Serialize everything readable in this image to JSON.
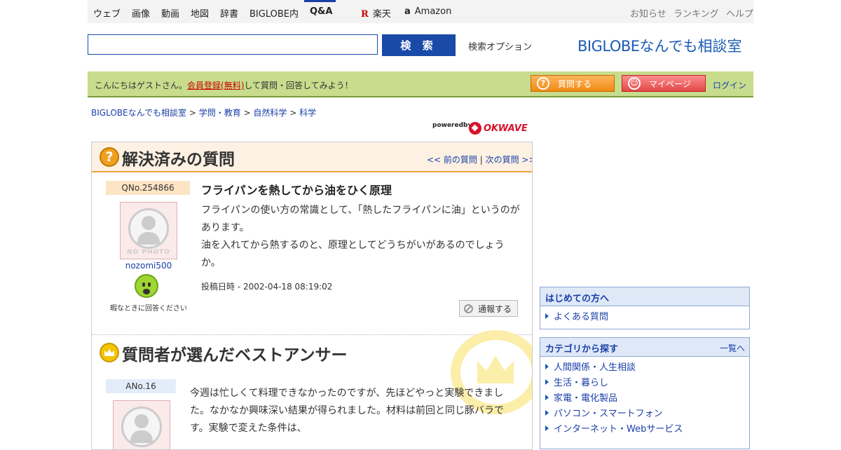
{
  "topnav": {
    "items": [
      "ウェブ",
      "画像",
      "動画",
      "地図",
      "辞書",
      "BIGLOBE内",
      "Q&A"
    ],
    "rakuten": "楽天",
    "amazon": "Amazon",
    "right": [
      "お知らせ",
      "ランキング",
      "ヘルプ"
    ]
  },
  "search": {
    "value": "",
    "button": "検 索",
    "option": "検索オプション",
    "brand_big": "BIGLOBE",
    "brand_rest": "なんでも相談室"
  },
  "greet": {
    "prefix": "こんにちはゲストさん。",
    "register": "会員登録(無料)",
    "suffix": "して質問・回答してみよう！",
    "ask_button": "質問する",
    "mypage_button": "マイページ",
    "login": "ログイン"
  },
  "breadcrumb": [
    "BIGLOBEなんでも相談室",
    "学問・教育",
    "自然科学",
    "科学"
  ],
  "powered": {
    "by": "poweredby",
    "okwave": "OKWAVE"
  },
  "question": {
    "section_title": "解決済みの質問",
    "prev": "<< 前の質問",
    "next": "次の質問 >>",
    "number": "QNo.254866",
    "title": "フライパンを熱してから油をひく原理",
    "body": "フライパンの使い方の常識として、「熱したフライパンに油」というのがあります。\n油を入れてから熱するのと、原理としてどうちがいがあるのでしょうか。",
    "posted": "投稿日時 - 2002-04-18 08:19:02",
    "report": "通報する",
    "user": {
      "name": "nozomi500",
      "no_photo": "NO PHOTO",
      "status": "暇なときに回答ください"
    }
  },
  "best": {
    "section_title": "質問者が選んだベストアンサー",
    "number": "ANo.16",
    "body": "今週は忙しくて料理できなかったのですが、先ほどやっと実験できました。なかなか興味深い結果が得られました。材料は前回と同じ豚バラです。実験で変えた条件は、"
  },
  "sidebar": {
    "first": {
      "title": "はじめての方へ",
      "items": [
        "よくある質問"
      ]
    },
    "categories": {
      "title": "カテゴリから探す",
      "more": "一覧へ",
      "items": [
        "人間関係・人生相談",
        "生活・暮らし",
        "家電・電化製品",
        "パソコン・スマートフォン",
        "インターネット・Webサービス"
      ]
    }
  }
}
